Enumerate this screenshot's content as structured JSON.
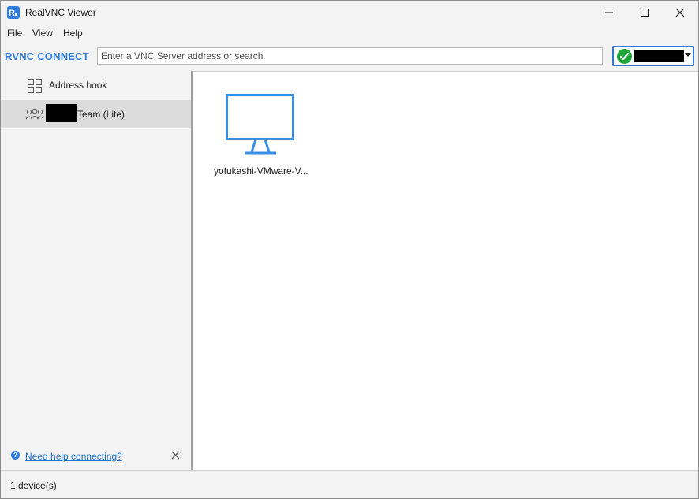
{
  "window": {
    "title": "RealVNC Viewer"
  },
  "menu": {
    "items": [
      "File",
      "View",
      "Help"
    ]
  },
  "toolbar": {
    "logo": "RVNC CONNECT",
    "search_placeholder": "Enter a VNC Server address or search"
  },
  "sidebar": {
    "items": [
      {
        "label": "Address book",
        "icon": "grid-icon"
      },
      {
        "label": "Team (Lite)",
        "icon": "team-icon"
      }
    ],
    "help_link": "Need help connecting?"
  },
  "main": {
    "devices": [
      {
        "name": "yofukashi-VMware-V...",
        "icon": "monitor-icon"
      }
    ]
  },
  "status": {
    "text": "1 device(s)"
  },
  "colors": {
    "accent": "#2d7de0",
    "check": "#1fa83a"
  }
}
